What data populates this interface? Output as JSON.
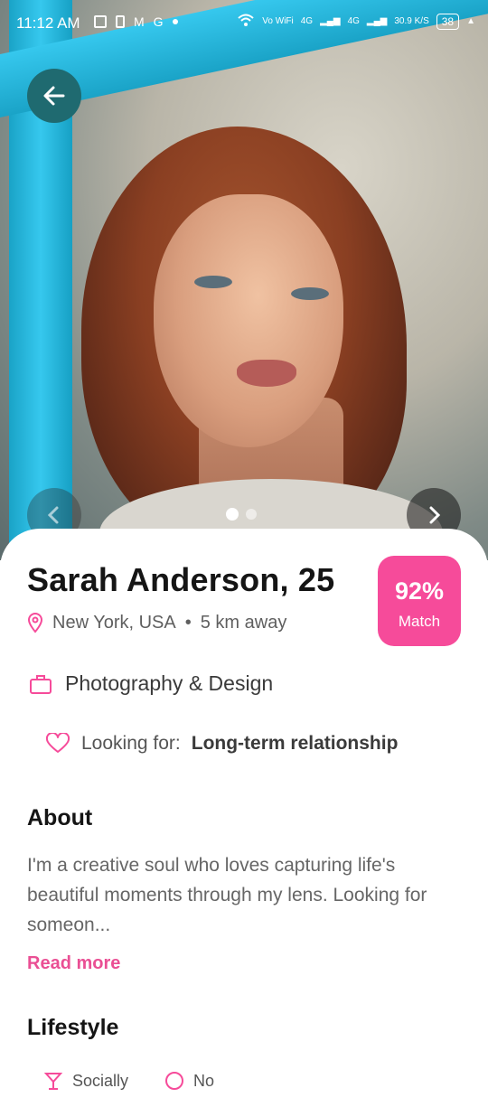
{
  "status": {
    "time": "11:12 AM",
    "net1": "Vo WiFi",
    "net2": "4G",
    "net3": "4G",
    "speed": "30.9 K/S",
    "battery": "38"
  },
  "gallery": {
    "total": 2,
    "active": 1
  },
  "profile": {
    "name": "Sarah Anderson, 25",
    "location": "New York, USA",
    "distance": "5 km away",
    "match_percent": "92%",
    "match_label": "Match",
    "occupation": "Photography & Design",
    "looking_label": "Looking for:",
    "looking_value": "Long-term relationship"
  },
  "about": {
    "heading": "About",
    "text": "I'm a creative soul who loves capturing life's beautiful moments through my lens. Looking for someon...",
    "read_more": "Read more"
  },
  "lifestyle": {
    "heading": "Lifestyle",
    "chips": [
      {
        "label": "Socially",
        "icon": "glass-icon"
      },
      {
        "label": "No",
        "icon": "smoking-icon"
      }
    ]
  },
  "colors": {
    "accent": "#f64b9a",
    "back_button": "#1f6a70"
  }
}
